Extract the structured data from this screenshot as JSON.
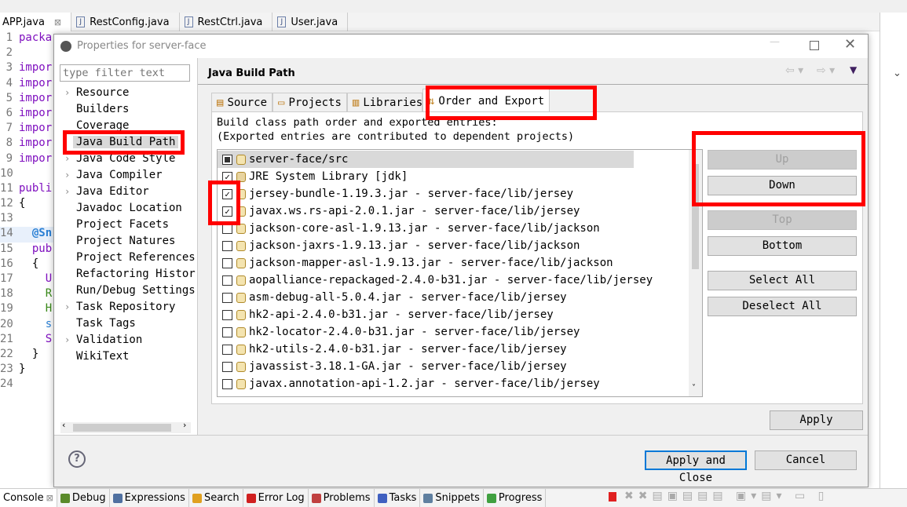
{
  "editor_tabs": [
    {
      "label": "APP.java",
      "active": true
    },
    {
      "label": "RestConfig.java"
    },
    {
      "label": "RestCtrl.java"
    },
    {
      "label": "User.java"
    }
  ],
  "code_lines": [
    {
      "n": "1",
      "t": "packa",
      "c": "#7f0fbf"
    },
    {
      "n": "2",
      "t": "",
      "c": "#000"
    },
    {
      "n": "3",
      "t": "impor",
      "c": "#7f0fbf"
    },
    {
      "n": "4",
      "t": "impor",
      "c": "#7f0fbf"
    },
    {
      "n": "5",
      "t": "impor",
      "c": "#7f0fbf"
    },
    {
      "n": "6",
      "t": "impor",
      "c": "#7f0fbf"
    },
    {
      "n": "7",
      "t": "impor",
      "c": "#7f0fbf"
    },
    {
      "n": "8",
      "t": "impor",
      "c": "#7f0fbf"
    },
    {
      "n": "9",
      "t": "impor",
      "c": "#7f0fbf"
    },
    {
      "n": "10",
      "t": "",
      "c": "#000"
    },
    {
      "n": "11",
      "t": "publi",
      "c": "#7f0fbf"
    },
    {
      "n": "12",
      "t": "{",
      "c": "#000"
    },
    {
      "n": "13",
      "t": "",
      "c": "#000"
    },
    {
      "n": "14",
      "t": "  @Sn",
      "c": "#2a7fd4"
    },
    {
      "n": "15",
      "t": "  pub",
      "c": "#7f0fbf"
    },
    {
      "n": "16",
      "t": "  {",
      "c": "#000"
    },
    {
      "n": "17",
      "t": "    U",
      "c": "#7f0fbf"
    },
    {
      "n": "18",
      "t": "    R",
      "c": "#3a8a1a"
    },
    {
      "n": "19",
      "t": "    H",
      "c": "#3a8a1a"
    },
    {
      "n": "20",
      "t": "    s",
      "c": "#2a7fd4"
    },
    {
      "n": "21",
      "t": "    S",
      "c": "#7f0fbf"
    },
    {
      "n": "22",
      "t": "  }",
      "c": "#000"
    },
    {
      "n": "23",
      "t": "}",
      "c": "#000"
    },
    {
      "n": "24",
      "t": "",
      "c": "#000"
    }
  ],
  "dialog": {
    "title": "Properties for server-face",
    "filter_placeholder": "type filter text",
    "tree": [
      {
        "label": "Resource",
        "arrow": true
      },
      {
        "label": "Builders"
      },
      {
        "label": "Coverage"
      },
      {
        "label": "Java Build Path",
        "selected": true
      },
      {
        "label": "Java Code Style",
        "arrow": true
      },
      {
        "label": "Java Compiler",
        "arrow": true
      },
      {
        "label": "Java Editor",
        "arrow": true
      },
      {
        "label": "Javadoc Location"
      },
      {
        "label": "Project Facets"
      },
      {
        "label": "Project Natures"
      },
      {
        "label": "Project References"
      },
      {
        "label": "Refactoring Histor"
      },
      {
        "label": "Run/Debug Settings"
      },
      {
        "label": "Task Repository",
        "arrow": true
      },
      {
        "label": "Task Tags"
      },
      {
        "label": "Validation",
        "arrow": true
      },
      {
        "label": "WikiText"
      }
    ],
    "page_title": "Java Build Path",
    "tabs": [
      {
        "label": "Source"
      },
      {
        "label": "Projects"
      },
      {
        "label": "Libraries"
      },
      {
        "label": "Order and Export",
        "active": true
      }
    ],
    "desc1": "Build class path order and exported entries:",
    "desc2": "(Exported entries are contributed to dependent projects)",
    "entries": [
      {
        "label": "server-face/src",
        "state": "partial",
        "icon": "folder"
      },
      {
        "label": "JRE System Library [jdk]",
        "state": "checked",
        "icon": "library"
      },
      {
        "label": "jersey-bundle-1.19.3.jar - server-face/lib/jersey",
        "state": "checked",
        "icon": "jar"
      },
      {
        "label": "javax.ws.rs-api-2.0.1.jar - server-face/lib/jersey",
        "state": "checked",
        "icon": "jar"
      },
      {
        "label": "jackson-core-asl-1.9.13.jar - server-face/lib/jackson",
        "state": "unchecked",
        "icon": "jar"
      },
      {
        "label": "jackson-jaxrs-1.9.13.jar - server-face/lib/jackson",
        "state": "unchecked",
        "icon": "jar"
      },
      {
        "label": "jackson-mapper-asl-1.9.13.jar - server-face/lib/jackson",
        "state": "unchecked",
        "icon": "jar"
      },
      {
        "label": "aopalliance-repackaged-2.4.0-b31.jar - server-face/lib/jersey",
        "state": "unchecked",
        "icon": "jar"
      },
      {
        "label": "asm-debug-all-5.0.4.jar - server-face/lib/jersey",
        "state": "unchecked",
        "icon": "jar"
      },
      {
        "label": "hk2-api-2.4.0-b31.jar - server-face/lib/jersey",
        "state": "unchecked",
        "icon": "jar"
      },
      {
        "label": "hk2-locator-2.4.0-b31.jar - server-face/lib/jersey",
        "state": "unchecked",
        "icon": "jar"
      },
      {
        "label": "hk2-utils-2.4.0-b31.jar - server-face/lib/jersey",
        "state": "unchecked",
        "icon": "jar"
      },
      {
        "label": "javassist-3.18.1-GA.jar - server-face/lib/jersey",
        "state": "unchecked",
        "icon": "jar"
      },
      {
        "label": "javax.annotation-api-1.2.jar - server-face/lib/jersey",
        "state": "unchecked",
        "icon": "jar"
      }
    ],
    "buttons": {
      "up": "Up",
      "down": "Down",
      "top": "Top",
      "bottom": "Bottom",
      "select_all": "Select All",
      "deselect_all": "Deselect All",
      "apply": "Apply",
      "apply_close": "Apply and Close",
      "cancel": "Cancel"
    }
  },
  "bottom_tabs": [
    {
      "label": "Console",
      "color": "#333"
    },
    {
      "label": "Debug",
      "color": "#5a8a2a"
    },
    {
      "label": "Expressions",
      "color": "#5070a0"
    },
    {
      "label": "Search",
      "color": "#e0a020"
    },
    {
      "label": "Error Log",
      "color": "#d02020"
    },
    {
      "label": "Problems",
      "color": "#c04040"
    },
    {
      "label": "Tasks",
      "color": "#4060c0"
    },
    {
      "label": "Snippets",
      "color": "#6080a0"
    },
    {
      "label": "Progress",
      "color": "#40a040"
    }
  ],
  "highlight_color": "#ff0000"
}
